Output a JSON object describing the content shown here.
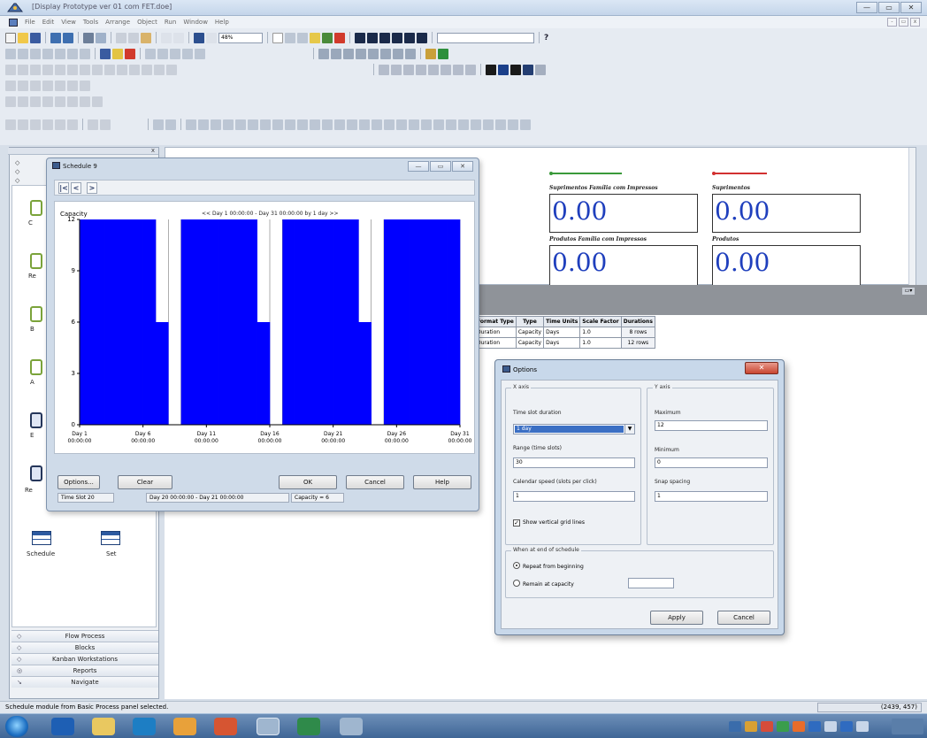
{
  "window": {
    "title": "[Display Prototype ver 01 com FET.doe]",
    "controls": [
      "—",
      "▭",
      "✕"
    ]
  },
  "menu": {
    "items": [
      "File",
      "Edit",
      "View",
      "Tools",
      "Arrange",
      "Object",
      "Run",
      "Window",
      "Help"
    ],
    "mdi_controls": [
      "-",
      "▭",
      "x"
    ]
  },
  "toolbar": {
    "zoom": "48%",
    "help_label": "?"
  },
  "model": {
    "vars": [
      {
        "title": "Suprimentos Família com Impressos",
        "value": "0.00",
        "color": "#3a9a3a"
      },
      {
        "title": "Suprimentos",
        "value": "0.00",
        "color": "#d23030"
      },
      {
        "title": "Produtos Família com Impressos",
        "value": "0.00"
      },
      {
        "title": "Produtos",
        "value": "0.00"
      }
    ]
  },
  "sheet": {
    "headers": [
      "Format Type",
      "Type",
      "Time Units",
      "Scale Factor",
      "Durations"
    ],
    "rows": [
      [
        "Duration",
        "Capacity",
        "Days",
        "1.0",
        "8 rows"
      ],
      [
        "Duration",
        "Capacity",
        "Days",
        "1.0",
        "12 rows"
      ]
    ]
  },
  "project_bar": {
    "grip_label": "x",
    "top_tabs": [
      "",
      "",
      ""
    ],
    "labels": [
      "C",
      "Re",
      "B",
      "A",
      "E",
      "Re",
      "Schedule",
      "Set"
    ],
    "bottom_tabs": [
      "Flow Process",
      "Blocks",
      "Kanban Workstations",
      "Reports",
      "Navigate"
    ]
  },
  "schedule": {
    "title": "Schedule 9",
    "controls": [
      "—",
      "▭",
      "✕"
    ],
    "nav": [
      "|<",
      "<",
      ">"
    ],
    "ylabel": "Capacity",
    "header": "<< Day 1 00:00:00 - Day 31 00:00:00 by 1 day >>",
    "buttons": {
      "options": "Options...",
      "clear": "Clear",
      "ok": "OK",
      "cancel": "Cancel",
      "help": "Help"
    },
    "status": [
      "Time Slot 20",
      "Day 20 00:00:00 - Day 21 00:00:00",
      "Capacity = 6"
    ]
  },
  "chart_data": {
    "type": "bar",
    "ylabel": "Capacity",
    "ylim": [
      0,
      12
    ],
    "yticks": [
      "0",
      "3",
      "6",
      "9",
      "12"
    ],
    "xticks": [
      "Day 1\n00:00:00",
      "Day 6\n00:00:00",
      "Day 11\n00:00:00",
      "Day 16\n00:00:00",
      "Day 21\n00:00:00",
      "Day 26\n00:00:00",
      "Day 31\n00:00:00"
    ],
    "slots": 30,
    "values": [
      12,
      12,
      12,
      12,
      12,
      12,
      6,
      0,
      12,
      12,
      12,
      12,
      12,
      12,
      6,
      0,
      12,
      12,
      12,
      12,
      12,
      12,
      6,
      0,
      12,
      12,
      12,
      12,
      12,
      12,
      6,
      0
    ],
    "color": "#0000ff",
    "grid_vertical": true
  },
  "options": {
    "title": "Options",
    "close": "✕",
    "xaxis": {
      "group": "X axis",
      "slot_duration_label": "Time slot duration",
      "slot_duration_value": "1 day",
      "range_label": "Range (time slots)",
      "range_value": "30",
      "speed_label": "Calendar speed (slots per click)",
      "speed_value": "1",
      "grid_label": "Show vertical grid lines",
      "grid_checked": true
    },
    "yaxis": {
      "group": "Y axis",
      "max_label": "Maximum",
      "max_value": "12",
      "min_label": "Minimum",
      "min_value": "0",
      "snap_label": "Snap spacing",
      "snap_value": "1"
    },
    "end": {
      "group": "When at end of schedule",
      "repeat_label": "Repeat from beginning",
      "remain_label": "Remain at capacity",
      "remain_value": ""
    },
    "buttons": {
      "apply": "Apply",
      "cancel": "Cancel"
    }
  },
  "statusbar": {
    "message": "Schedule module from Basic Process panel selected.",
    "coords": "(2439, 457)"
  }
}
